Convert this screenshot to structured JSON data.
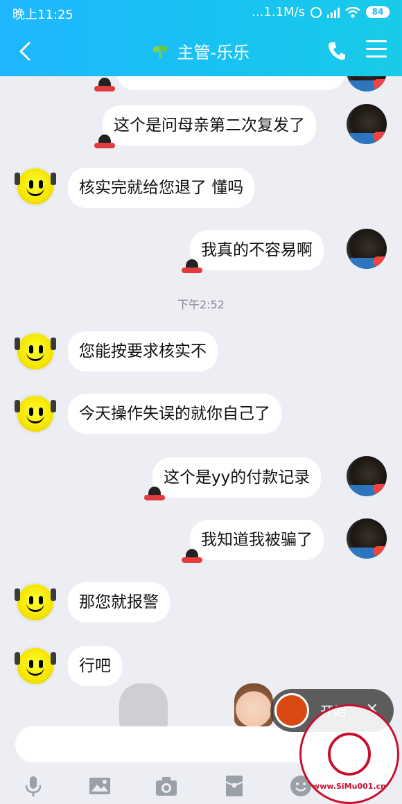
{
  "status_bar": {
    "time": "晚上11:25",
    "network_speed": "...1.1M/s",
    "battery": "84"
  },
  "header": {
    "title": "主管-乐乐",
    "back_icon": "chevron-left-icon",
    "call_icon": "phone-icon",
    "menu_icon": "menu-icon"
  },
  "messages": [
    {
      "side": "right",
      "text": "这个是问母亲第二次复发了"
    },
    {
      "side": "left",
      "text": "核实完就给您退了 懂吗"
    },
    {
      "side": "right",
      "text": "我真的不容易啊"
    },
    {
      "side": "left",
      "text": "您能按要求核实不"
    },
    {
      "side": "left",
      "text": "今天操作失误的就你自己了"
    },
    {
      "side": "right",
      "text": "这个是yy的付款记录"
    },
    {
      "side": "right",
      "text": "我知道我被骗了"
    },
    {
      "side": "left",
      "text": "那您就报警"
    },
    {
      "side": "left",
      "text": "行吧"
    }
  ],
  "timestamp": "下午2:52",
  "toolbar": [
    "microphone-icon",
    "image-icon",
    "camera-icon",
    "red-packet-icon",
    "emoji-icon"
  ],
  "recording_overlay": {
    "label": "开始",
    "close": "×"
  },
  "watermark": {
    "text": "www.SiMu001.cn"
  },
  "colors": {
    "header": "#1bb8f8",
    "background": "#eceef3",
    "bubble": "#ffffff",
    "record": "#d94a12"
  }
}
